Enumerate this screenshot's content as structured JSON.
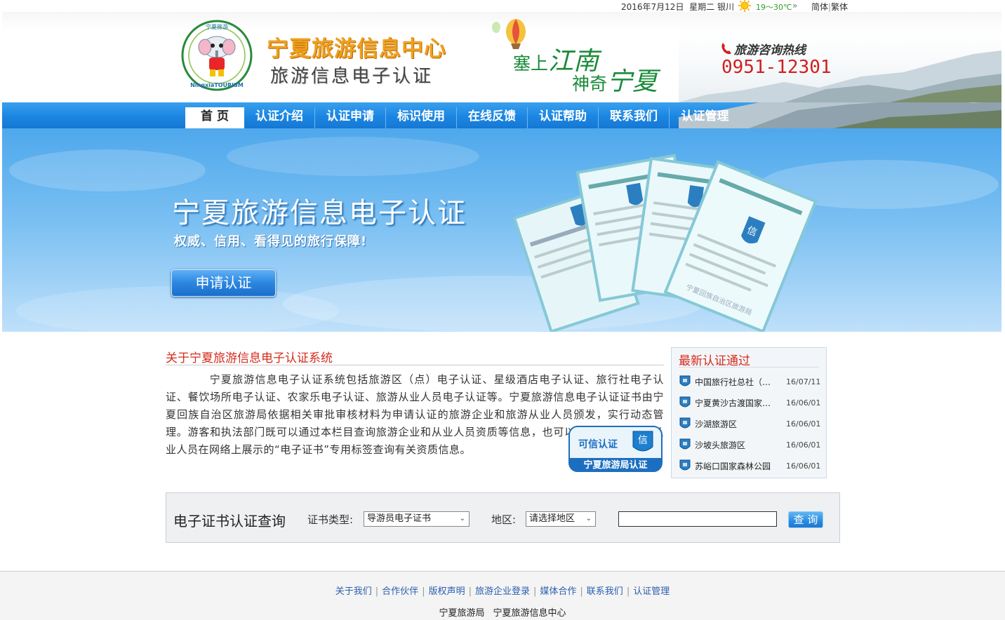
{
  "topbar": {
    "date": "2016年7月12日",
    "weekday": "星期二",
    "city": "银川",
    "temp": "19～30℃",
    "arrow": "»",
    "lang_simplified": "简体",
    "lang_separator": "|",
    "lang_traditional": "繁体"
  },
  "header": {
    "logo_text_top": "宁夏旅游",
    "logo_text_bottom": "NingxiaTOURISM",
    "title": "宁夏旅游信息中心",
    "subtitle": "旅游信息电子认证",
    "slogan_line1_a": "塞上",
    "slogan_line1_b": "江南",
    "slogan_line2_a": "神奇",
    "slogan_line2_b": "宁夏",
    "hotline_label": "旅游咨询热线",
    "hotline_number": "0951-12301"
  },
  "nav": {
    "items": [
      {
        "label": "首 页",
        "active": true
      },
      {
        "label": "认证介绍"
      },
      {
        "label": "认证申请"
      },
      {
        "label": "标识使用"
      },
      {
        "label": "在线反馈"
      },
      {
        "label": "认证帮助"
      },
      {
        "label": "联系我们"
      },
      {
        "label": "认证管理"
      }
    ]
  },
  "banner": {
    "title": "宁夏旅游信息电子认证",
    "subtitle": "权威、信用、看得见的旅行保障!",
    "button": "申请认证",
    "cert_badge": "信",
    "cert_watermark": "宁夏回族自治区旅游局"
  },
  "about": {
    "title": "关于宁夏旅游信息电子认证系统",
    "text": "宁夏旅游信息电子认证系统包括旅游区（点）电子认证、星级酒店电子认证、旅行社电子认证、餐饮场所电子认证、农家乐电子认证、旅游从业人员电子认证等。宁夏旅游信息电子认证证书由宁夏回族自治区旅游局依据相关审批审核材料为申请认证的旅游企业和旅游从业人员颁发，实行动态管理。游客和执法部门既可以通过本栏目查询旅游企业和从业人员资质等信息，也可以通过旅游企业和从业人员在网络上展示的“电子证书”专用标签查询有关资质信息。",
    "badge_left": "可信认证",
    "badge_icon": "信",
    "badge_bottom": "宁夏旅游局认证"
  },
  "latest": {
    "title": "最新认证通过",
    "items": [
      {
        "name": "中国旅行社总社（宁夏）",
        "date": "16/07/11"
      },
      {
        "name": "宁夏黄沙古渡国家沙漠公园",
        "date": "16/06/01"
      },
      {
        "name": "沙湖旅游区",
        "date": "16/06/01"
      },
      {
        "name": "沙坡头旅游区",
        "date": "16/06/01"
      },
      {
        "name": "苏峪口国家森林公园",
        "date": "16/06/01"
      }
    ]
  },
  "query": {
    "title": "电子证书认证查询",
    "type_label": "证书类型:",
    "type_value": "导游员电子证书",
    "region_label": "地区:",
    "region_value": "请选择地区",
    "input_value": "",
    "button": "查 询"
  },
  "footer": {
    "links": [
      "关于我们",
      "合作伙伴",
      "版权声明",
      "旅游企业登录",
      "媒体合作",
      "联系我们",
      "认证管理"
    ],
    "separator": "|",
    "org1": "宁夏旅游局",
    "org2": "宁夏旅游信息中心"
  },
  "colors": {
    "nav_blue": "#1b86e2",
    "title_red": "#d42c1c",
    "hotline_red": "#d02020",
    "slogan_green": "#1a8a3a",
    "title_orange": "#f0a020"
  }
}
